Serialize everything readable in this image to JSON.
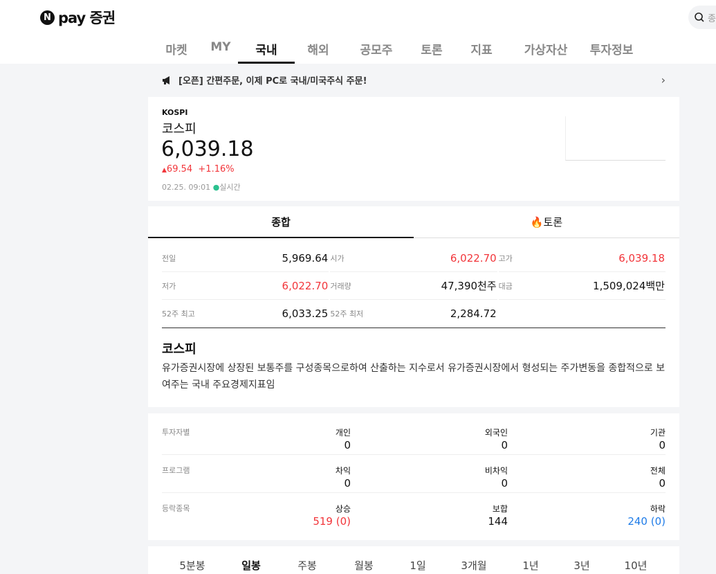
{
  "header": {
    "logo_text": "pay 증권",
    "logo_badge": "N",
    "search_placeholder": "종",
    "nav": [
      {
        "label": "마켓"
      },
      {
        "label": "MY"
      },
      {
        "label": "국내",
        "active": true
      },
      {
        "label": "해외"
      },
      {
        "label": "공모주"
      },
      {
        "label": "토론"
      },
      {
        "label": "지표"
      },
      {
        "label": "가상자산"
      },
      {
        "label": "투자정보"
      }
    ]
  },
  "notice": {
    "text": "[오픈] 간편주문, 이제 PC로 국내/미국주식 주문!",
    "icon": "megaphone-icon"
  },
  "index": {
    "code": "KOSPI",
    "name": "코스피",
    "price": "6,039.18",
    "change": "69.54",
    "change_pct": "+1.16%",
    "timestamp": "02.25. 09:01",
    "status": "실시간",
    "up_color": "#f2353a",
    "live_color": "#2bc18f"
  },
  "tabs": [
    {
      "label": "종합",
      "active": true
    },
    {
      "label": "토론",
      "icon": "fire-icon"
    }
  ],
  "stats": [
    [
      {
        "label": "전일",
        "value": "5,969.64",
        "color": "default"
      },
      {
        "label": "시가",
        "value": "6,022.70",
        "color": "red"
      },
      {
        "label": "고가",
        "value": "6,039.18",
        "color": "red"
      }
    ],
    [
      {
        "label": "저가",
        "value": "6,022.70",
        "color": "red"
      },
      {
        "label": "거래량",
        "value": "47,390천주",
        "color": "default"
      },
      {
        "label": "대금",
        "value": "1,509,024백만",
        "color": "default"
      }
    ],
    [
      {
        "label": "52주 최고",
        "value": "6,033.25",
        "color": "default"
      },
      {
        "label": "52주 최저",
        "value": "2,284.72",
        "color": "default"
      },
      {
        "label": "",
        "value": "",
        "color": "default"
      }
    ]
  ],
  "description": {
    "title": "코스피",
    "text": "유가증권시장에 상장된 보통주를 구성종목으로하여 산출하는 지수로서 유가증권시장에서 형성되는 주가변동을 종합적으로 보여주는 국내 주요경제지표임"
  },
  "investors": [
    {
      "label": "투자자별",
      "cols": [
        {
          "h": "개인",
          "v": "0"
        },
        {
          "h": "외국인",
          "v": "0"
        },
        {
          "h": "기관",
          "v": "0"
        }
      ]
    },
    {
      "label": "프로그램",
      "cols": [
        {
          "h": "차익",
          "v": "0"
        },
        {
          "h": "비차익",
          "v": "0"
        },
        {
          "h": "전체",
          "v": "0"
        }
      ]
    },
    {
      "label": "등락종목",
      "cols": [
        {
          "h": "상승",
          "v": "519 (0)",
          "color": "red"
        },
        {
          "h": "보합",
          "v": "144"
        },
        {
          "h": "하락",
          "v": "240 (0)",
          "color": "blue"
        }
      ]
    }
  ],
  "chart_tabs": [
    {
      "label": "5분봉"
    },
    {
      "label": "일봉",
      "active": true
    },
    {
      "label": "주봉"
    },
    {
      "label": "월봉"
    },
    {
      "label": "1일"
    },
    {
      "label": "3개월"
    },
    {
      "label": "1년"
    },
    {
      "label": "3년"
    },
    {
      "label": "10년"
    }
  ]
}
